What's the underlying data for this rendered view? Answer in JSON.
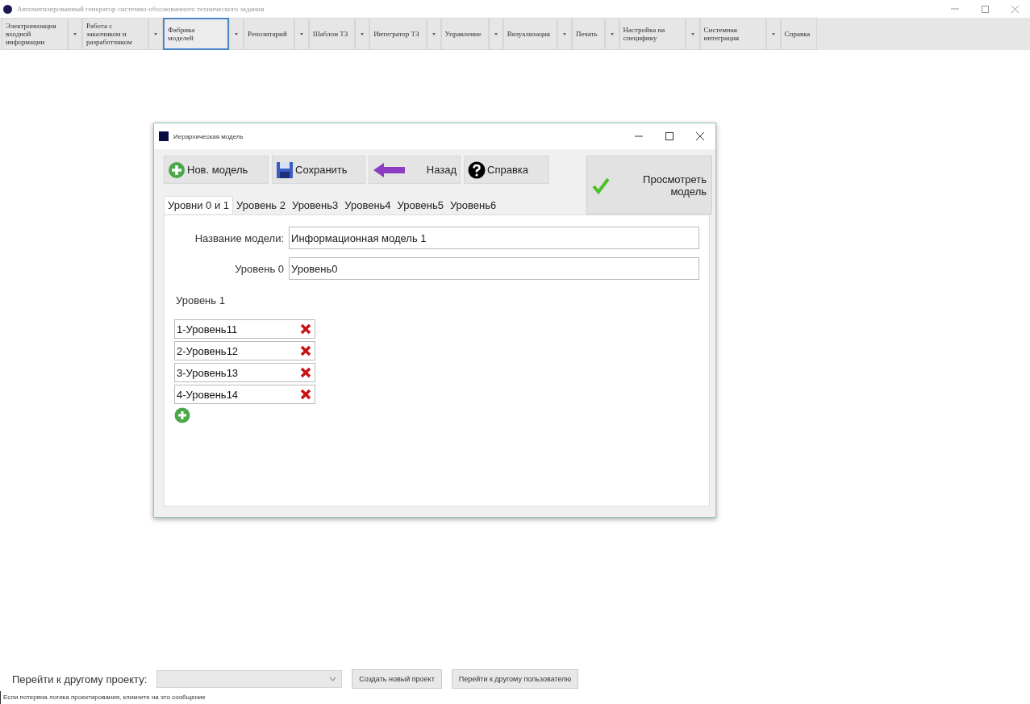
{
  "window": {
    "title": "Автоматизированный генератор системно-обоснованного технического задания"
  },
  "menu": [
    {
      "label": "Электронизация входной информации",
      "selected": false,
      "has_dropdown": true
    },
    {
      "label": "Работа с заказчиком и разработчиком",
      "selected": false,
      "has_dropdown": true
    },
    {
      "label": "Фабрика моделей",
      "selected": true,
      "has_dropdown": true
    },
    {
      "label": "Репозитарий",
      "selected": false,
      "has_dropdown": true
    },
    {
      "label": "Шаблон ТЗ",
      "selected": false,
      "has_dropdown": true
    },
    {
      "label": "Интегратор ТЗ",
      "selected": false,
      "has_dropdown": true
    },
    {
      "label": "Управление",
      "selected": false,
      "has_dropdown": true
    },
    {
      "label": "Визуализация",
      "selected": false,
      "has_dropdown": true
    },
    {
      "label": "Печать",
      "selected": false,
      "has_dropdown": true
    },
    {
      "label": "Настройка на специфику",
      "selected": false,
      "has_dropdown": true
    },
    {
      "label": "Системная интеграция",
      "selected": false,
      "has_dropdown": true
    },
    {
      "label": "Справка",
      "selected": false,
      "has_dropdown": false
    }
  ],
  "dialog": {
    "title": "Иерархическая модель",
    "toolbar": [
      {
        "kind": "new",
        "label": "Нов. модель"
      },
      {
        "kind": "save",
        "label": "Сохранить"
      },
      {
        "kind": "back",
        "label": "Назад"
      },
      {
        "kind": "help",
        "label": "Справка"
      }
    ],
    "view_button": "Просмотреть модель",
    "tabs": [
      {
        "label": "Уровни 0 и 1",
        "selected": true
      },
      {
        "label": "Уровень 2",
        "selected": false
      },
      {
        "label": "Уровень3",
        "selected": false
      },
      {
        "label": "Уровень4",
        "selected": false
      },
      {
        "label": "Уровень5",
        "selected": false
      },
      {
        "label": "Уровень6",
        "selected": false
      }
    ],
    "model_name": {
      "label": "Название модели:",
      "value": "Информационная модель 1"
    },
    "level0": {
      "label": "Уровень 0",
      "value": "Уровень0"
    },
    "level1": {
      "label": "Уровень 1",
      "items": [
        "1-Уровень11",
        "2-Уровень12",
        "3-Уровень13",
        "4-Уровень14"
      ]
    }
  },
  "bottom": {
    "project_label": "Перейти к другому проекту:",
    "buttons": [
      "Создать новый проект",
      "Перейти к другому пользователю"
    ]
  },
  "status_bar": "Если потеряна логика проектирования, кликните на это сообщение"
}
